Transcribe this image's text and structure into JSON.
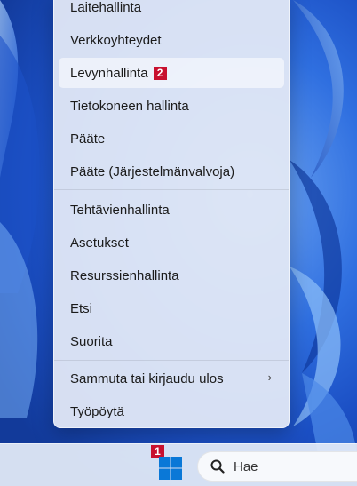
{
  "menu": {
    "items": [
      {
        "label": "Laitehallinta"
      },
      {
        "label": "Verkkoyhteydet"
      },
      {
        "label": "Levynhallinta",
        "badge": "2"
      },
      {
        "label": "Tietokoneen hallinta"
      },
      {
        "label": "Pääte"
      },
      {
        "label": "Pääte (Järjestelmänvalvoja)"
      },
      {
        "label": "Tehtävienhallinta"
      },
      {
        "label": "Asetukset"
      },
      {
        "label": "Resurssienhallinta"
      },
      {
        "label": "Etsi"
      },
      {
        "label": "Suorita"
      },
      {
        "label": "Sammuta tai kirjaudu ulos",
        "chevron": "›"
      },
      {
        "label": "Työpöytä"
      }
    ]
  },
  "taskbar": {
    "start_badge": "1",
    "start_icon": "windows-logo-icon",
    "search": {
      "icon": "search-icon",
      "label": "Hae"
    }
  },
  "colors": {
    "badge": "#c8102e",
    "windows_logo": "#0a78d7"
  }
}
